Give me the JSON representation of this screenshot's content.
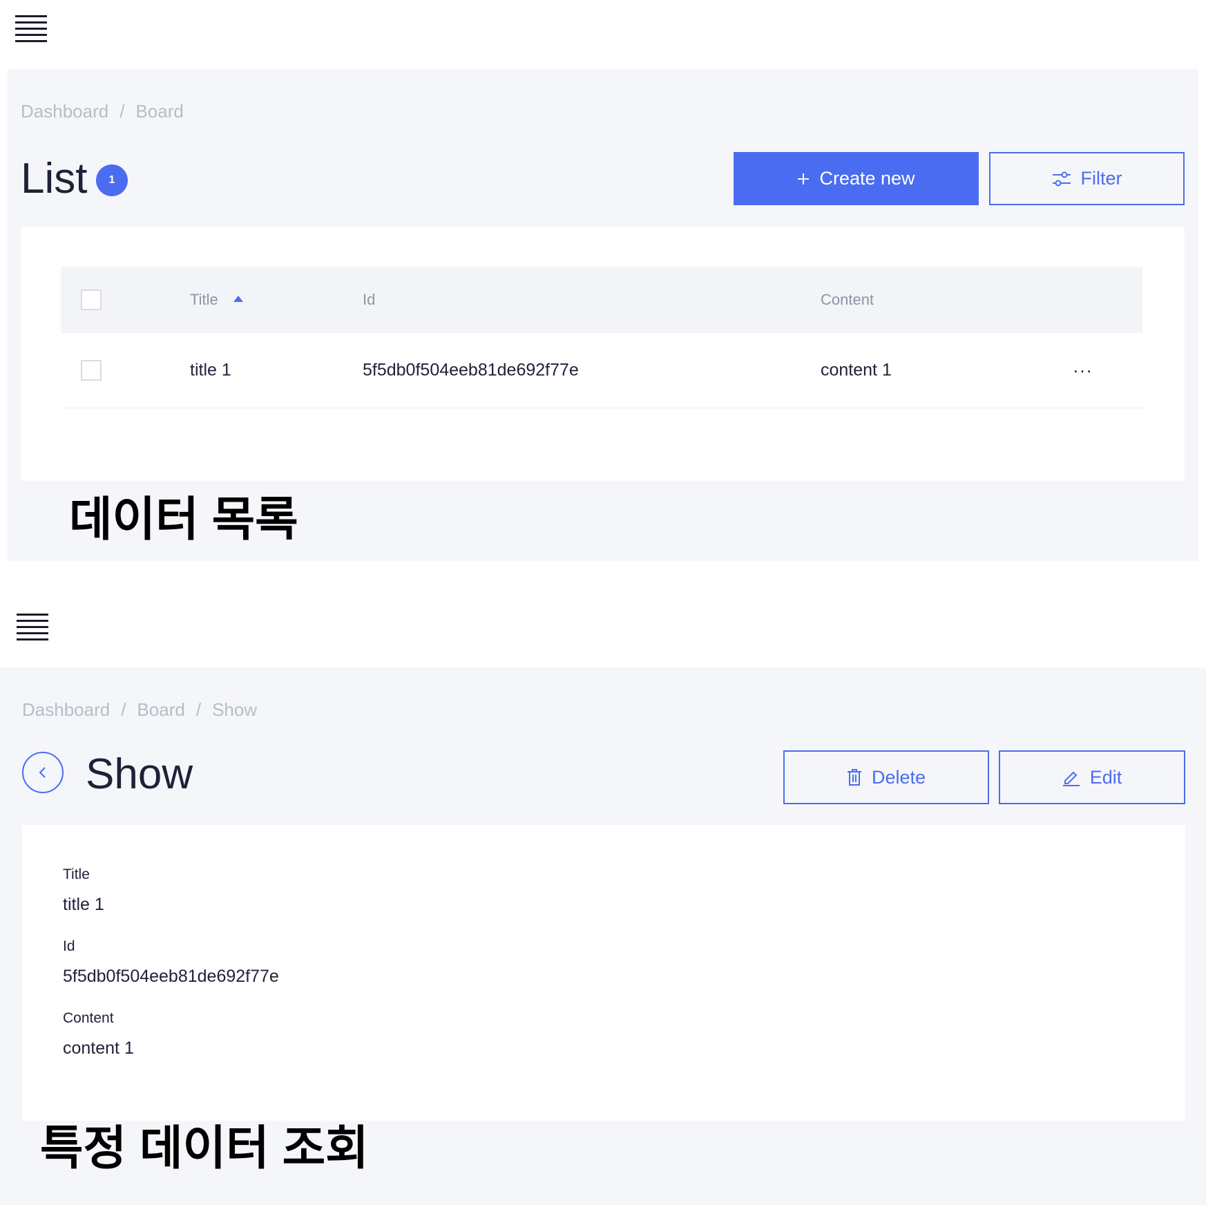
{
  "list_view": {
    "menu_icon": "hamburger-menu-icon",
    "breadcrumb": [
      "Dashboard",
      "Board"
    ],
    "title": "List",
    "count": "1",
    "create_button": {
      "icon": "plus-icon",
      "label": "Create new"
    },
    "filter_button": {
      "icon": "sliders-icon",
      "label": "Filter"
    },
    "table": {
      "headers": {
        "title": "Title",
        "id": "Id",
        "content": "Content"
      },
      "sort": {
        "column": "Title",
        "direction": "ascending"
      },
      "rows": [
        {
          "title": "title 1",
          "id": "5f5db0f504eeb81de692f77e",
          "content": "content 1",
          "actions": "···"
        }
      ]
    },
    "caption": "데이터 목록"
  },
  "show_view": {
    "menu_icon": "hamburger-menu-icon",
    "breadcrumb": [
      "Dashboard",
      "Board",
      "Show"
    ],
    "title": "Show",
    "back_icon": "chevron-left-icon",
    "delete_button": {
      "icon": "trash-icon",
      "label": "Delete"
    },
    "edit_button": {
      "icon": "pencil-icon",
      "label": "Edit"
    },
    "fields": [
      {
        "label": "Title",
        "value": "title 1"
      },
      {
        "label": "Id",
        "value": "5f5db0f504eeb81de692f77e"
      },
      {
        "label": "Content",
        "value": "content 1"
      }
    ],
    "caption": "특정 데이터 조회"
  },
  "colors": {
    "accent": "#4a6cf0",
    "panel_background": "#f5f6fa",
    "card_background": "#ffffff",
    "breadcrumb_text": "#b8bcc6",
    "header_text": "#8f93a3",
    "body_text": "#1f2137"
  }
}
